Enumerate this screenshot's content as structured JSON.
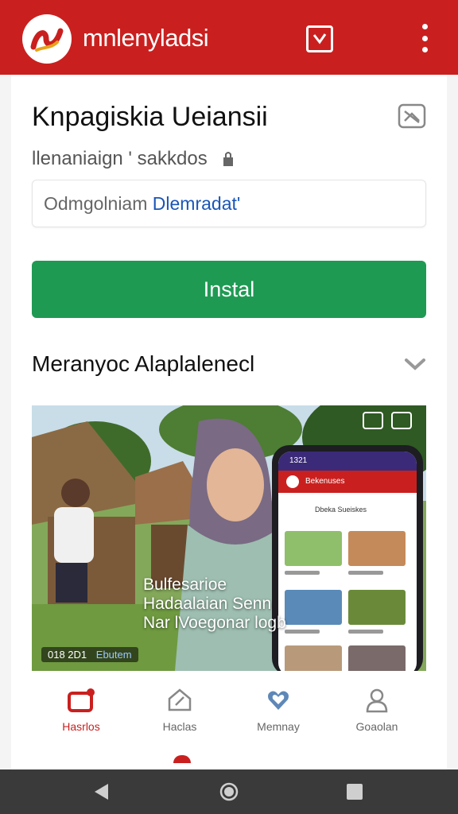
{
  "appbar": {
    "brand": "mnlenyladsi",
    "logo_icon": "app-logo-icon",
    "action_icon": "checkbox-icon",
    "menu_icon": "more-vertical-icon",
    "color": "#c9201f"
  },
  "app": {
    "title": "Knpagiskia Ueiansii",
    "subtitle": "llenaniaign ' sakkdos",
    "subtitle_icon": "lock-icon",
    "share_icon": "share-icon",
    "info_label": "Odmgolniam",
    "info_link": "Dlemradat'",
    "install_label": "Instal",
    "install_color": "#1f9a53"
  },
  "section": {
    "title": "Meranyoc Alaplalenecl",
    "chevron_icon": "chevron-down-icon"
  },
  "promo": {
    "overlay_lines": [
      "Bulfesarioe",
      "Hadaalaian Senn",
      "Nar lVoegonar logb"
    ],
    "badge_code": "018 2D1",
    "badge_app": "Ebutem",
    "phone_status": "1321",
    "phone_title": "Bekenuses",
    "phone_section": "Dbeka Sueiskes"
  },
  "bottom_nav": [
    {
      "label": "Hasrlos",
      "icon": "store-icon",
      "active": true
    },
    {
      "label": "Haclas",
      "icon": "edit-icon",
      "active": false
    },
    {
      "label": "Memnay",
      "icon": "heart-icon",
      "active": false
    },
    {
      "label": "Goaolan",
      "icon": "profile-icon",
      "active": false
    }
  ],
  "system_nav": {
    "back_icon": "back-triangle-icon",
    "home_icon": "home-circle-icon",
    "recents_icon": "recents-square-icon"
  }
}
